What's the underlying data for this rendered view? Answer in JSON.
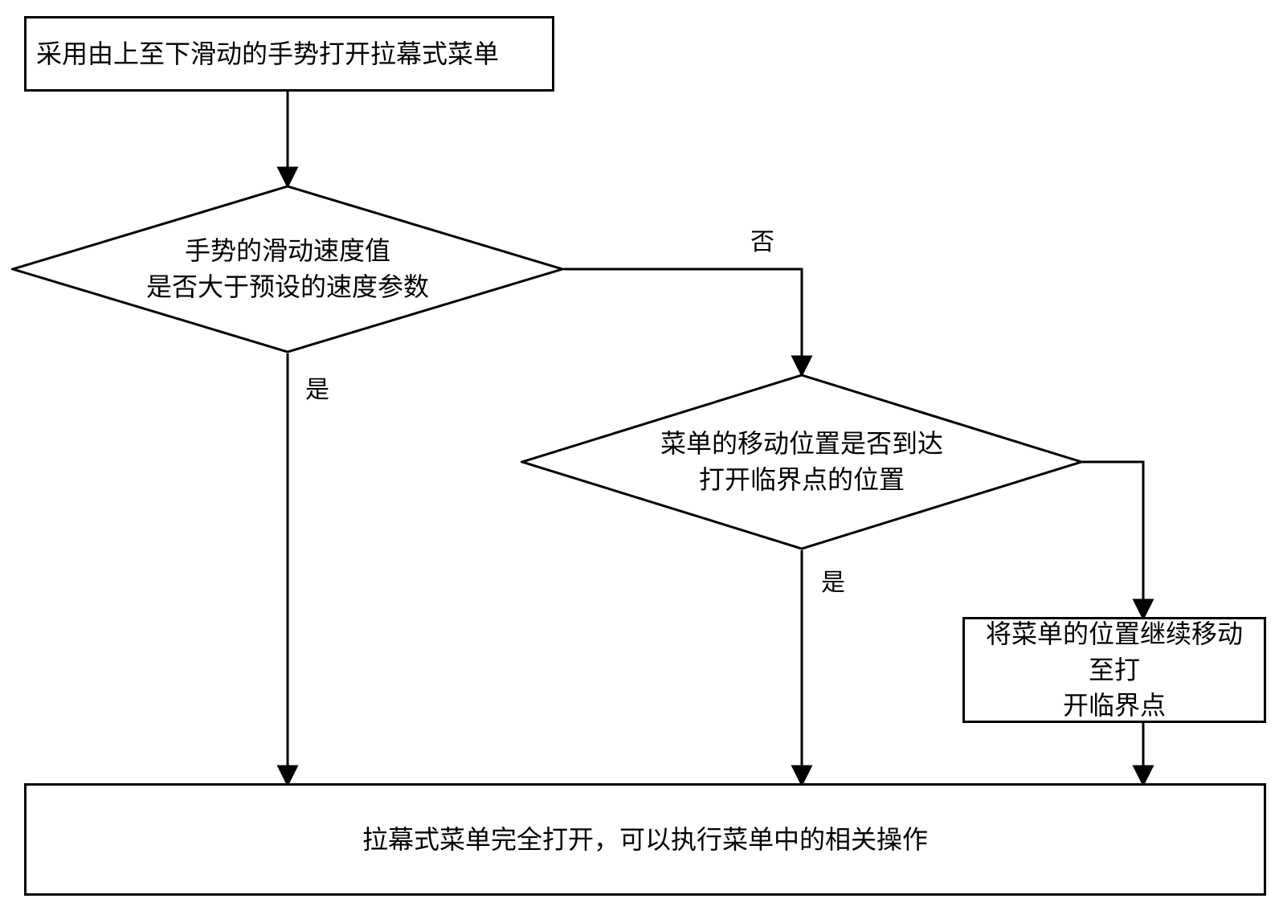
{
  "flow": {
    "type": "flowchart",
    "nodes": {
      "start": {
        "shape": "rect",
        "text": "采用由上至下滑动的手势打开拉幕式菜单"
      },
      "decision1": {
        "shape": "diamond",
        "text": "手势的滑动速度值\n是否大于预设的速度参数"
      },
      "decision2": {
        "shape": "diamond",
        "text": "菜单的移动位置是否到达\n打开临界点的位置"
      },
      "action": {
        "shape": "rect",
        "text": "将菜单的位置继续移动至打\n开临界点"
      },
      "end": {
        "shape": "rect",
        "text": "拉幕式菜单完全打开，可以执行菜单中的相关操作"
      }
    },
    "edges": [
      {
        "from": "start",
        "to": "decision1",
        "label": ""
      },
      {
        "from": "decision1",
        "to": "end",
        "label": "是",
        "branch": "yes"
      },
      {
        "from": "decision1",
        "to": "decision2",
        "label": "否",
        "branch": "no"
      },
      {
        "from": "decision2",
        "to": "end",
        "label": "是",
        "branch": "yes"
      },
      {
        "from": "decision2",
        "to": "action",
        "label": "",
        "branch": "no"
      },
      {
        "from": "action",
        "to": "end",
        "label": ""
      }
    ],
    "labels": {
      "yes": "是",
      "no": "否"
    }
  }
}
